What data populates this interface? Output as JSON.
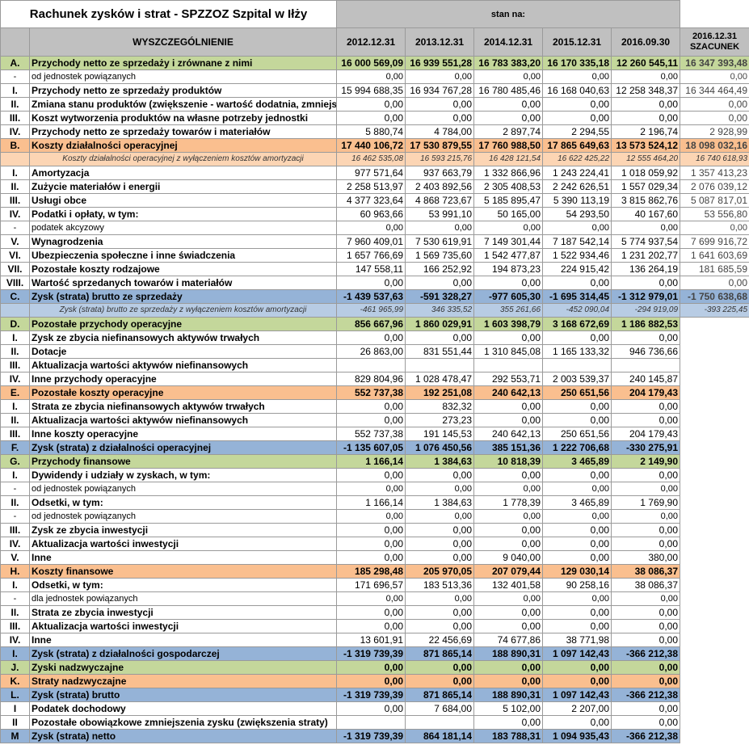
{
  "title": "Rachunek zysków i strat - SPZZOZ Szpital w Iłży",
  "stan_na": "stan na:",
  "header": {
    "col_name": "WYSZCZEGÓLNIENIE",
    "years": [
      "2012.12.31",
      "2013.12.31",
      "2014.12.31",
      "2015.12.31",
      "2016.09.30"
    ],
    "estimate_line1": "2016.12.31",
    "estimate_line2": "SZACUNEK"
  },
  "rows": [
    {
      "id": "A",
      "label": "A.",
      "name": "Przychody netto ze sprzedaży i zrównane z nimi",
      "values": [
        "16 000 569,09",
        "16 939 551,28",
        "16 783 383,20",
        "16 170 335,18",
        "12 260 545,11"
      ],
      "estimate": "16 347 393,48"
    },
    {
      "id": "A-0",
      "label": "-",
      "name": "od jednostek powiązanych",
      "values": [
        "0,00",
        "0,00",
        "0,00",
        "0,00",
        "0,00"
      ],
      "estimate": "0,00"
    },
    {
      "id": "A-1",
      "label": "I.",
      "name": "Przychody netto ze sprzedaży produktów",
      "values": [
        "15 994 688,35",
        "16 934 767,28",
        "16 780 485,46",
        "16 168 040,63",
        "12 258 348,37"
      ],
      "estimate": "16 344 464,49"
    },
    {
      "id": "A-2",
      "label": "II.",
      "name": "Zmiana stanu produktów (zwiększenie - wartość dodatnia, zmniejszenie",
      "values": [
        "0,00",
        "0,00",
        "0,00",
        "0,00",
        "0,00"
      ],
      "estimate": "0,00"
    },
    {
      "id": "A-3",
      "label": "III.",
      "name": "Koszt wytworzenia produktów na własne potrzeby jednostki",
      "values": [
        "0,00",
        "0,00",
        "0,00",
        "0,00",
        "0,00"
      ],
      "estimate": "0,00"
    },
    {
      "id": "A-4",
      "label": "IV.",
      "name": "Przychody netto ze sprzedaży towarów i materiałów",
      "values": [
        "5 880,74",
        "4 784,00",
        "2 897,74",
        "2 294,55",
        "2 196,74"
      ],
      "estimate": "2 928,99"
    },
    {
      "id": "B",
      "label": "B.",
      "name": "Koszty działalności operacyjnej",
      "values": [
        "17 440 106,72",
        "17 530 879,55",
        "17 760 988,50",
        "17 865 649,63",
        "13 573 524,12"
      ],
      "estimate": "18 098 032,16"
    },
    {
      "id": "B-x",
      "label": "",
      "name": "Koszty działalności operacyjnej z wyłączeniem kosztów amortyzacji",
      "values": [
        "16 462 535,08",
        "16 593 215,76",
        "16 428 121,54",
        "16 622 425,22",
        "12 555 464,20"
      ],
      "estimate": "16 740 618,93"
    },
    {
      "id": "B-1",
      "label": "I.",
      "name": "Amortyzacja",
      "values": [
        "977 571,64",
        "937 663,79",
        "1 332 866,96",
        "1 243 224,41",
        "1 018 059,92"
      ],
      "estimate": "1 357 413,23"
    },
    {
      "id": "B-2",
      "label": "II.",
      "name": "Zużycie materiałów i energii",
      "values": [
        "2 258 513,97",
        "2 403 892,56",
        "2 305 408,53",
        "2 242 626,51",
        "1 557 029,34"
      ],
      "estimate": "2 076 039,12"
    },
    {
      "id": "B-3",
      "label": "III.",
      "name": "Usługi obce",
      "values": [
        "4 377 323,64",
        "4 868 723,67",
        "5 185 895,47",
        "5 390 113,19",
        "3 815 862,76"
      ],
      "estimate": "5 087 817,01"
    },
    {
      "id": "B-4",
      "label": "IV.",
      "name": "Podatki i opłaty, w tym:",
      "values": [
        "60 963,66",
        "53 991,10",
        "50 165,00",
        "54 293,50",
        "40 167,60"
      ],
      "estimate": "53 556,80"
    },
    {
      "id": "B-4a",
      "label": "-",
      "name": "podatek akcyzowy",
      "values": [
        "0,00",
        "0,00",
        "0,00",
        "0,00",
        "0,00"
      ],
      "estimate": "0,00"
    },
    {
      "id": "B-5",
      "label": "V.",
      "name": "Wynagrodzenia",
      "values": [
        "7 960 409,01",
        "7 530 619,91",
        "7 149 301,44",
        "7 187 542,14",
        "5 774 937,54"
      ],
      "estimate": "7 699 916,72"
    },
    {
      "id": "B-6",
      "label": "VI.",
      "name": "Ubezpieczenia społeczne i inne świadczenia",
      "values": [
        "1 657 766,69",
        "1 569 735,60",
        "1 542 477,87",
        "1 522 934,46",
        "1 231 202,77"
      ],
      "estimate": "1 641 603,69"
    },
    {
      "id": "B-7",
      "label": "VII.",
      "name": "Pozostałe koszty rodzajowe",
      "values": [
        "147 558,11",
        "166 252,92",
        "194 873,23",
        "224 915,42",
        "136 264,19"
      ],
      "estimate": "181 685,59"
    },
    {
      "id": "B-8",
      "label": "VIII.",
      "name": "Wartość sprzedanych towarów i materiałów",
      "values": [
        "0,00",
        "0,00",
        "0,00",
        "0,00",
        "0,00"
      ],
      "estimate": "0,00"
    },
    {
      "id": "C",
      "label": "C.",
      "name": "Zysk (strata) brutto ze sprzedaży",
      "values": [
        "-1 439 537,63",
        "-591 328,27",
        "-977 605,30",
        "-1 695 314,45",
        "-1 312 979,01"
      ],
      "estimate": "-1 750 638,68"
    },
    {
      "id": "C-x",
      "label": "",
      "name": "Zysk (strata) brutto ze sprzedaży z wyłączeniem kosztów amortyzacji",
      "values": [
        "-461 965,99",
        "346 335,52",
        "355 261,66",
        "-452 090,04",
        "-294 919,09"
      ],
      "estimate": "-393 225,45"
    },
    {
      "id": "D",
      "label": "D.",
      "name": "Pozostałe przychody operacyjne",
      "values": [
        "856 667,96",
        "1 860 029,91",
        "1 603 398,79",
        "3 168 672,69",
        "1 186 882,53"
      ],
      "estimate": ""
    },
    {
      "id": "D-1",
      "label": "I.",
      "name": "Zysk ze zbycia niefinansowych aktywów trwałych",
      "values": [
        "0,00",
        "0,00",
        "0,00",
        "0,00",
        "0,00"
      ],
      "estimate": ""
    },
    {
      "id": "D-2",
      "label": "II.",
      "name": "Dotacje",
      "values": [
        "26 863,00",
        "831 551,44",
        "1 310 845,08",
        "1 165 133,32",
        "946 736,66"
      ],
      "estimate": ""
    },
    {
      "id": "D-3",
      "label": "III.",
      "name": "Aktualizacja wartości aktywów niefinansowych",
      "values": [
        "",
        "",
        "",
        "",
        ""
      ],
      "estimate": ""
    },
    {
      "id": "D-4",
      "label": "IV.",
      "name": "Inne przychody operacyjne",
      "values": [
        "829 804,96",
        "1 028 478,47",
        "292 553,71",
        "2 003 539,37",
        "240 145,87"
      ],
      "estimate": ""
    },
    {
      "id": "E",
      "label": "E.",
      "name": "Pozostałe koszty operacyjne",
      "values": [
        "552 737,38",
        "192 251,08",
        "240 642,13",
        "250 651,56",
        "204 179,43"
      ],
      "estimate": ""
    },
    {
      "id": "E-1",
      "label": "I.",
      "name": "Strata ze zbycia niefinansowych aktywów trwałych",
      "values": [
        "0,00",
        "832,32",
        "0,00",
        "0,00",
        "0,00"
      ],
      "estimate": ""
    },
    {
      "id": "E-2",
      "label": "II.",
      "name": "Aktualizacja wartości aktywów niefinansowych",
      "values": [
        "0,00",
        "273,23",
        "0,00",
        "0,00",
        "0,00"
      ],
      "estimate": ""
    },
    {
      "id": "E-3",
      "label": "III.",
      "name": "Inne koszty operacyjne",
      "values": [
        "552 737,38",
        "191 145,53",
        "240 642,13",
        "250 651,56",
        "204 179,43"
      ],
      "estimate": ""
    },
    {
      "id": "F",
      "label": "F.",
      "name": "Zysk (strata) z działalności operacyjnej",
      "values": [
        "-1 135 607,05",
        "1 076 450,56",
        "385 151,36",
        "1 222 706,68",
        "-330 275,91"
      ],
      "estimate": ""
    },
    {
      "id": "G",
      "label": "G.",
      "name": "Przychody finansowe",
      "values": [
        "1 166,14",
        "1 384,63",
        "10 818,39",
        "3 465,89",
        "2 149,90"
      ],
      "estimate": ""
    },
    {
      "id": "G-1",
      "label": "I.",
      "name": "Dywidendy i udziały w zyskach, w tym:",
      "values": [
        "0,00",
        "0,00",
        "0,00",
        "0,00",
        "0,00"
      ],
      "estimate": ""
    },
    {
      "id": "G-1a",
      "label": "-",
      "name": "od jednostek powiązanych",
      "values": [
        "0,00",
        "0,00",
        "0,00",
        "0,00",
        "0,00"
      ],
      "estimate": ""
    },
    {
      "id": "G-2",
      "label": "II.",
      "name": "Odsetki, w tym:",
      "values": [
        "1 166,14",
        "1 384,63",
        "1 778,39",
        "3 465,89",
        "1 769,90"
      ],
      "estimate": ""
    },
    {
      "id": "G-2a",
      "label": "-",
      "name": "od jednostek powiązanych",
      "values": [
        "0,00",
        "0,00",
        "0,00",
        "0,00",
        "0,00"
      ],
      "estimate": ""
    },
    {
      "id": "G-3",
      "label": "III.",
      "name": "Zysk ze zbycia inwestycji",
      "values": [
        "0,00",
        "0,00",
        "0,00",
        "0,00",
        "0,00"
      ],
      "estimate": ""
    },
    {
      "id": "G-4",
      "label": "IV.",
      "name": "Aktualizacja wartości inwestycji",
      "values": [
        "0,00",
        "0,00",
        "0,00",
        "0,00",
        "0,00"
      ],
      "estimate": ""
    },
    {
      "id": "G-5",
      "label": "V.",
      "name": "Inne",
      "values": [
        "0,00",
        "0,00",
        "9 040,00",
        "0,00",
        "380,00"
      ],
      "estimate": ""
    },
    {
      "id": "H",
      "label": "H.",
      "name": "Koszty finansowe",
      "values": [
        "185 298,48",
        "205 970,05",
        "207 079,44",
        "129 030,14",
        "38 086,37"
      ],
      "estimate": ""
    },
    {
      "id": "H-1",
      "label": "I.",
      "name": "Odsetki, w tym:",
      "values": [
        "171 696,57",
        "183 513,36",
        "132 401,58",
        "90 258,16",
        "38 086,37"
      ],
      "estimate": ""
    },
    {
      "id": "H-1a",
      "label": "-",
      "name": "dla jednostek powiązanych",
      "values": [
        "0,00",
        "0,00",
        "0,00",
        "0,00",
        "0,00"
      ],
      "estimate": ""
    },
    {
      "id": "H-2",
      "label": "II.",
      "name": "Strata ze zbycia inwestycji",
      "values": [
        "0,00",
        "0,00",
        "0,00",
        "0,00",
        "0,00"
      ],
      "estimate": ""
    },
    {
      "id": "H-3",
      "label": "III.",
      "name": "Aktualizacja wartości inwestycji",
      "values": [
        "0,00",
        "0,00",
        "0,00",
        "0,00",
        "0,00"
      ],
      "estimate": ""
    },
    {
      "id": "H-4",
      "label": "IV.",
      "name": "Inne",
      "values": [
        "13 601,91",
        "22 456,69",
        "74 677,86",
        "38 771,98",
        "0,00"
      ],
      "estimate": ""
    },
    {
      "id": "I",
      "label": "I.",
      "name": "Zysk (strata) z działalności gospodarczej",
      "values": [
        "-1 319 739,39",
        "871 865,14",
        "188 890,31",
        "1 097 142,43",
        "-366 212,38"
      ],
      "estimate": ""
    },
    {
      "id": "J",
      "label": "J.",
      "name": "Zyski nadzwyczajne",
      "values": [
        "0,00",
        "0,00",
        "0,00",
        "0,00",
        "0,00"
      ],
      "estimate": ""
    },
    {
      "id": "K",
      "label": "K.",
      "name": "Straty nadzwyczajne",
      "values": [
        "0,00",
        "0,00",
        "0,00",
        "0,00",
        "0,00"
      ],
      "estimate": ""
    },
    {
      "id": "L",
      "label": "L.",
      "name": "Zysk (strata) brutto",
      "values": [
        "-1 319 739,39",
        "871 865,14",
        "188 890,31",
        "1 097 142,43",
        "-366 212,38"
      ],
      "estimate": ""
    },
    {
      "id": "L-1",
      "label": "I",
      "name": "Podatek dochodowy",
      "values": [
        "0,00",
        "7 684,00",
        "5 102,00",
        "2 207,00",
        "0,00"
      ],
      "estimate": ""
    },
    {
      "id": "L-2",
      "label": "II",
      "name": "Pozostałe obowiązkowe zmniejszenia zysku (zwiększenia straty)",
      "values": [
        "",
        "",
        "0,00",
        "0,00",
        "0,00"
      ],
      "estimate": ""
    },
    {
      "id": "M",
      "label": "M",
      "name": "Zysk (strata) netto",
      "values": [
        "-1 319 739,39",
        "864 181,14",
        "183 788,31",
        "1 094 935,43",
        "-366 212,38"
      ],
      "estimate": ""
    }
  ],
  "colors": {
    "header_grey": "#c0c0c0",
    "green": "#c4d79b",
    "orange": "#fabf8f",
    "blue": "#95b3d7"
  }
}
